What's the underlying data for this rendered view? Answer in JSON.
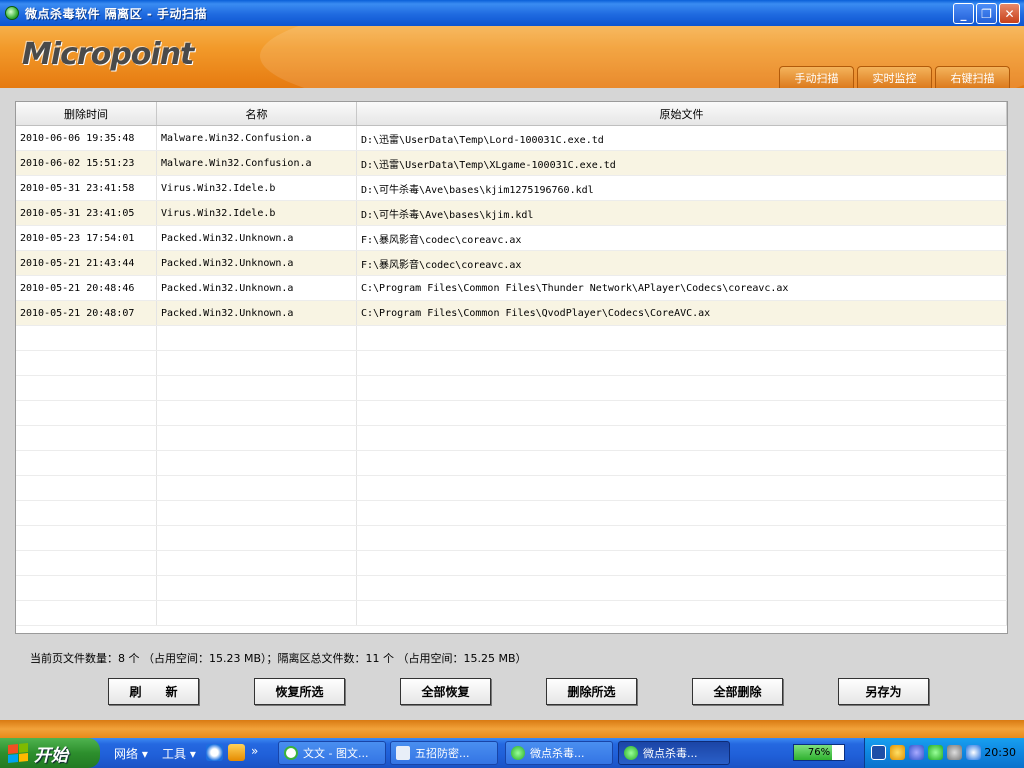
{
  "window": {
    "title": "微点杀毒软件  隔离区  - 手动扫描",
    "minimize": "_",
    "restore": "❐",
    "close": "✕"
  },
  "header": {
    "logo": "Micropoint",
    "tabs": [
      "手动扫描",
      "实时监控",
      "右键扫描"
    ]
  },
  "table": {
    "headers": [
      "删除时间",
      "名称",
      "原始文件"
    ],
    "rows": [
      {
        "time": "2010-06-06 19:35:48",
        "name": "Malware.Win32.Confusion.a",
        "file": "D:\\迅雷\\UserData\\Temp\\Lord-100031C.exe.td"
      },
      {
        "time": "2010-06-02 15:51:23",
        "name": "Malware.Win32.Confusion.a",
        "file": "D:\\迅雷\\UserData\\Temp\\XLgame-100031C.exe.td"
      },
      {
        "time": "2010-05-31 23:41:58",
        "name": "Virus.Win32.Idele.b",
        "file": "D:\\可牛杀毒\\Ave\\bases\\kjim1275196760.kdl"
      },
      {
        "time": "2010-05-31 23:41:05",
        "name": "Virus.Win32.Idele.b",
        "file": "D:\\可牛杀毒\\Ave\\bases\\kjim.kdl"
      },
      {
        "time": "2010-05-23 17:54:01",
        "name": "Packed.Win32.Unknown.a",
        "file": "F:\\暴风影音\\codec\\coreavc.ax"
      },
      {
        "time": "2010-05-21 21:43:44",
        "name": "Packed.Win32.Unknown.a",
        "file": "F:\\暴风影音\\codec\\coreavc.ax"
      },
      {
        "time": "2010-05-21 20:48:46",
        "name": "Packed.Win32.Unknown.a",
        "file": "C:\\Program Files\\Common Files\\Thunder Network\\APlayer\\Codecs\\coreavc.ax"
      },
      {
        "time": "2010-05-21 20:48:07",
        "name": "Packed.Win32.Unknown.a",
        "file": "C:\\Program Files\\Common Files\\QvodPlayer\\Codecs\\CoreAVC.ax"
      }
    ]
  },
  "summary": "当前页文件数量：8 个 （占用空间：15.23 MB）；隔离区总文件数：11 个 （占用空间：15.25 MB）",
  "buttons": [
    "刷　　新",
    "恢复所选",
    "全部恢复",
    "删除所选",
    "全部删除",
    "另存为"
  ],
  "taskbar": {
    "start": "开始",
    "network": "网络",
    "tools": "工具",
    "tasks": [
      "文文 - 图文...",
      "五招防密...",
      "微点杀毒...",
      "微点杀毒..."
    ],
    "progress": 76,
    "progress_label": "76%",
    "clock": "20:30"
  }
}
